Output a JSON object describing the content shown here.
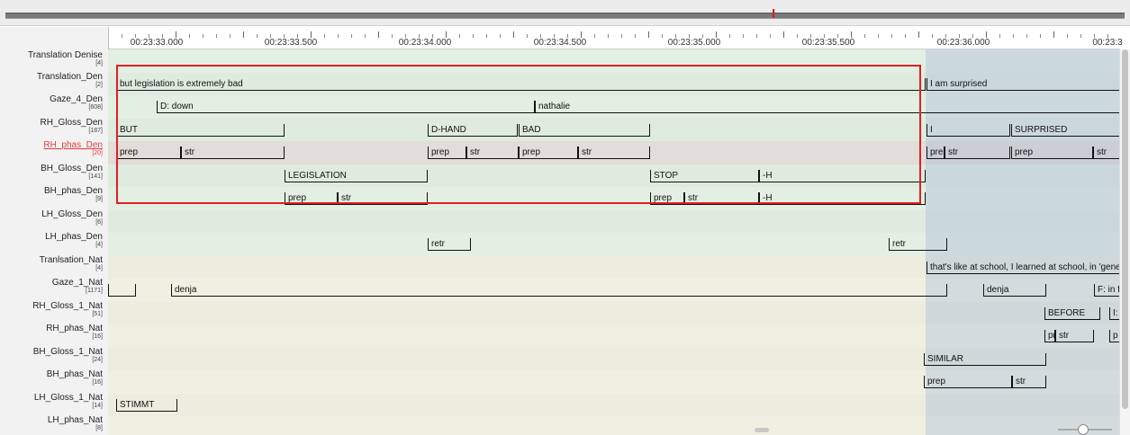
{
  "ruler": {
    "labels": [
      "00:23:33.000",
      "00:23:33.500",
      "00:23:34.000",
      "00:23:34.500",
      "00:23:35.000",
      "00:23:35.500",
      "00:23:36.000",
      "00:23:3"
    ]
  },
  "tiers": [
    {
      "name": "Translation Denise",
      "count": "[4]"
    },
    {
      "name": "Translation_Den",
      "count": "[2]"
    },
    {
      "name": "Gaze_4_Den",
      "count": "[608]"
    },
    {
      "name": "RH_Gloss_Den",
      "count": "[187]"
    },
    {
      "name": "RH_phas_Den",
      "count": "[20]"
    },
    {
      "name": "BH_Gloss_Den",
      "count": "[141]"
    },
    {
      "name": "BH_phas_Den",
      "count": "[9]"
    },
    {
      "name": "LH_Gloss_Den",
      "count": "[6]"
    },
    {
      "name": "LH_phas_Den",
      "count": "[4]"
    },
    {
      "name": "Tranlsation_Nat",
      "count": "[4]"
    },
    {
      "name": "Gaze_1_Nat",
      "count": "[1171]"
    },
    {
      "name": "RH_Gloss_1_Nat",
      "count": "[51]"
    },
    {
      "name": "RH_phas_Nat",
      "count": "[16]"
    },
    {
      "name": "BH_Gloss_1_Nat",
      "count": "[24]"
    },
    {
      "name": "BH_phas_Nat",
      "count": "[16]"
    },
    {
      "name": "LH_Gloss_1_Nat",
      "count": "[14]"
    },
    {
      "name": "LH_phas_Nat",
      "count": "[8]"
    }
  ],
  "annotations": {
    "translation_den": [
      "but legislation is extremely bad",
      "I am surprised"
    ],
    "gaze_den": [
      "D: down",
      "nathalie"
    ],
    "rh_gloss_den": [
      "BUT",
      "D-HAND",
      "BAD",
      "I",
      "SURPRISED"
    ],
    "rh_phas_den": [
      "prep",
      "str",
      "prep",
      "str",
      "prep",
      "str",
      "pre",
      "str",
      "prep",
      "str"
    ],
    "bh_gloss_den": [
      "LEGISLATION",
      "STOP",
      "-H"
    ],
    "bh_phas_den": [
      "prep",
      "str",
      "prep",
      "str",
      "-H"
    ],
    "lh_phas_den": [
      "retr",
      "retr"
    ],
    "translation_nat": [
      "that's like at school, I learned at school, in 'genera"
    ],
    "gaze_nat": [
      "denja",
      "denja",
      "F: in front"
    ],
    "rh_gloss_nat": [
      "BEFORE",
      "I:"
    ],
    "rh_phas_nat": [
      "pre",
      "str",
      "p"
    ],
    "bh_gloss_nat": [
      "SIMILAR"
    ],
    "bh_phas_nat": [
      "prep",
      "str"
    ],
    "lh_gloss_nat": [
      "STIMMT"
    ]
  },
  "colors": {
    "den_rows": "#e3efe3",
    "den_active_row": "#e2ddd8",
    "nat_rows": "#f0f0e2",
    "highlight": "#e02020",
    "cursor": "#d32020"
  }
}
